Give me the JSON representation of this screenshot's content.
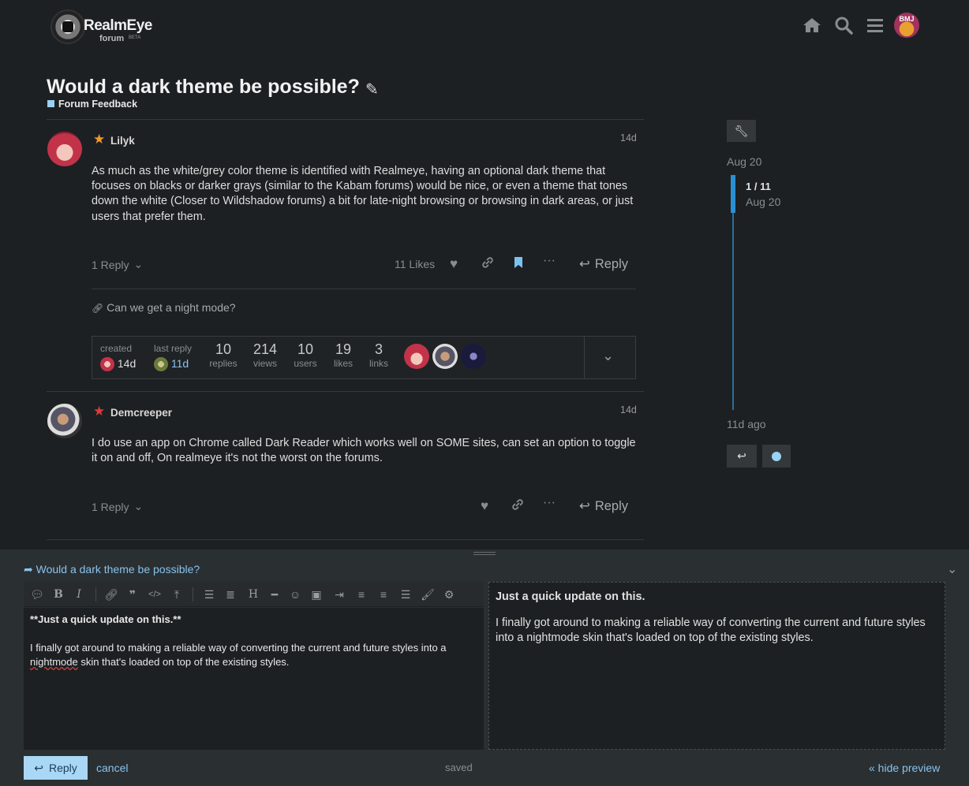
{
  "header": {
    "brand": "RealmEye",
    "brand_sub": "forum",
    "brand_beta": "BETA",
    "user_initials": "BMJ",
    "icons": [
      "home-icon",
      "search-icon",
      "hamburger-menu-icon"
    ]
  },
  "topic": {
    "title": "Would a dark theme be possible?",
    "category": "Forum Feedback",
    "category_color": "#9bd1f5"
  },
  "posts": [
    {
      "username": "Lilyk",
      "badge_color": "#f39a2b",
      "date": "14d",
      "body": "As much as the white/grey color theme is identified with Realmeye, having an optional dark theme that focuses on blacks or darker grays (similar to the Kabam forums) would be nice, or even a theme that tones down the white (Closer to Wildshadow forums) a bit for late-night browsing or browsing in dark areas, or just users that prefer them.",
      "replies": "1 Reply",
      "likes": "11 Likes",
      "reply_label": "Reply",
      "link": "Can we get a night mode?"
    },
    {
      "username": "Demcreeper",
      "badge_color": "#e03a3a",
      "date": "14d",
      "body": "I do use an app on Chrome called Dark Reader which works well on SOME sites, can set an option to toggle it on and off, On realmeye it's not the worst on the forums.",
      "replies": "1 Reply",
      "reply_label": "Reply"
    }
  ],
  "topic_map": {
    "created_label": "created",
    "created_value": "14d",
    "last_reply_label": "last reply",
    "last_reply_value": "11d",
    "stats": [
      {
        "value": "10",
        "label": "replies"
      },
      {
        "value": "214",
        "label": "views"
      },
      {
        "value": "10",
        "label": "users"
      },
      {
        "value": "19",
        "label": "likes"
      },
      {
        "value": "3",
        "label": "links"
      }
    ]
  },
  "timeline": {
    "start_date": "Aug 20",
    "position": "1 / 11",
    "position_date": "Aug 20",
    "end_label": "11d ago"
  },
  "composer": {
    "title": "Would a dark theme be possible?",
    "editor_line1": "**Just a quick update on this.**",
    "editor_line2": "I finally got around to making a reliable way of converting the current and future styles into a",
    "editor_word_misspelled": "nightmode",
    "editor_line3_rest": " skin that's loaded on top of the existing styles.",
    "preview_heading": "Just a quick update on this.",
    "preview_body": "I finally got around to making a reliable way of converting the current and future styles into a nightmode skin that's loaded on top of the existing styles.",
    "reply_label": "Reply",
    "cancel_label": "cancel",
    "status": "saved",
    "hide_preview_label": "« hide preview"
  }
}
